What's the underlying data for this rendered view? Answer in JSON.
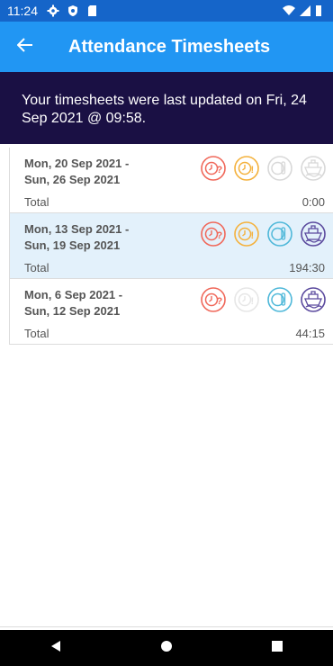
{
  "status_bar": {
    "time": "11:24",
    "icons": [
      "settings-icon",
      "shield-icon",
      "sd-card-icon",
      "wifi-icon",
      "signal-icon",
      "battery-icon"
    ]
  },
  "app_bar": {
    "title": "Attendance Timesheets",
    "back_icon": "arrow-back-icon"
  },
  "banner": {
    "text": "Your timesheets were last updated on Fri, 24 Sep 2021 @ 09:58."
  },
  "colors": {
    "status_bar": "#1565c9",
    "app_bar": "#2196f3",
    "banner": "#1a1044",
    "selected_row": "#e3f1fb",
    "icon_red": "#f0685a",
    "icon_orange": "#f4b13c",
    "icon_blue": "#4fb8d9",
    "icon_purple": "#5b4a9e",
    "icon_disabled": "#d8d8d8"
  },
  "timesheets": [
    {
      "dates_line1": "Mon, 20 Sep 2021 -",
      "dates_line2": "Sun, 26 Sep 2021",
      "total_label": "Total",
      "total": "0:00",
      "selected": false,
      "icons": [
        "clock-question-icon (red)",
        "clock-alert-icon (orange)",
        "clock-approved-icon (disabled)",
        "ship-icon (disabled)"
      ]
    },
    {
      "dates_line1": "Mon, 13 Sep 2021 -",
      "dates_line2": "Sun, 19 Sep 2021",
      "total_label": "Total",
      "total": "194:30",
      "selected": true,
      "icons": [
        "clock-question-icon (red)",
        "clock-alert-icon (orange)",
        "clock-approved-icon (blue)",
        "ship-icon (purple)"
      ]
    },
    {
      "dates_line1": "Mon, 6 Sep 2021 -",
      "dates_line2": "Sun, 12 Sep 2021",
      "total_label": "Total",
      "total": "44:15",
      "selected": false,
      "icons": [
        "clock-question-icon (red)",
        "clock-alert-icon (disabled)",
        "clock-approved-icon (blue)",
        "ship-icon (purple)"
      ]
    }
  ],
  "nav_bar": {
    "icons": [
      "back-triangle-icon",
      "home-circle-icon",
      "recents-square-icon"
    ]
  }
}
